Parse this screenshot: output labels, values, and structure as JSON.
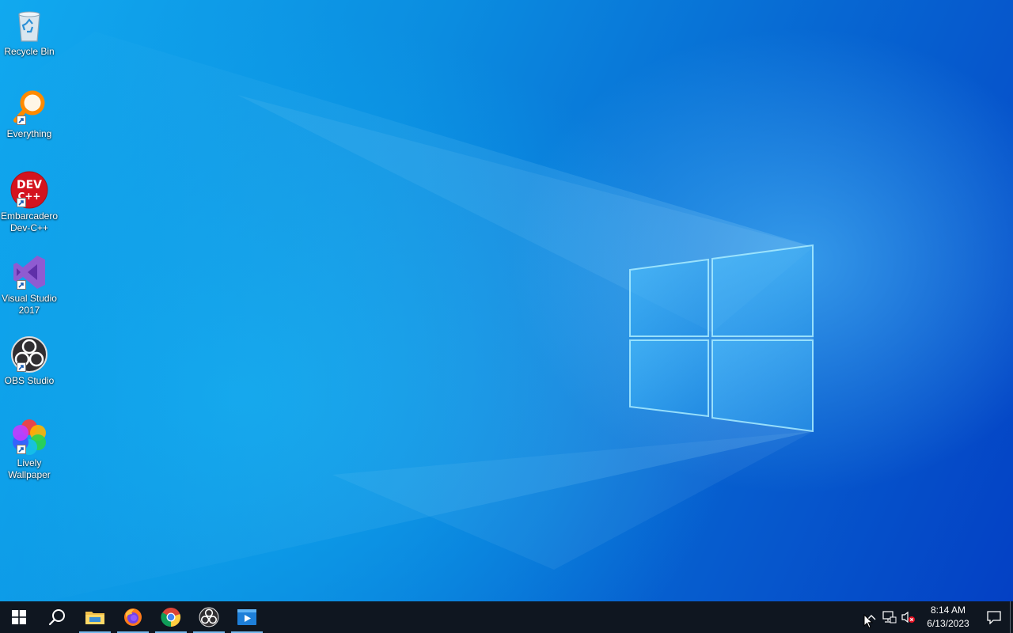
{
  "desktop": {
    "icons": [
      {
        "label": "Recycle Bin",
        "icon": "recycle-bin-icon"
      },
      {
        "label": "Everything",
        "icon": "everything-search-icon"
      },
      {
        "label": "Embarcadero Dev-C++",
        "icon": "devcpp-icon",
        "badge": "DEV C++"
      },
      {
        "label": "Visual Studio 2017",
        "icon": "visual-studio-icon"
      },
      {
        "label": "OBS Studio",
        "icon": "obs-studio-icon"
      },
      {
        "label": "Lively Wallpaper",
        "icon": "lively-wallpaper-icon"
      }
    ]
  },
  "taskbar": {
    "start": {
      "icon": "windows-start-icon"
    },
    "search": {
      "icon": "search-icon"
    },
    "pinned": [
      {
        "name": "File Explorer",
        "icon": "file-explorer-icon",
        "running": true
      },
      {
        "name": "Firefox",
        "icon": "firefox-icon",
        "running": true
      },
      {
        "name": "Chrome",
        "icon": "chrome-icon",
        "running": true
      },
      {
        "name": "OBS Studio",
        "icon": "obs-studio-icon",
        "running": true
      },
      {
        "name": "Media Player",
        "icon": "media-player-icon",
        "running": true
      }
    ],
    "tray": {
      "icons": [
        "show-hidden-icons-chevron-icon",
        "network-icon",
        "volume-muted-icon",
        "notification-icon"
      ],
      "time": "8:14 AM",
      "date": "6/13/2023"
    }
  },
  "colors": {
    "taskbar": "#0f1620",
    "wallpaper_blue": "#0a78d8",
    "running_indicator": "#76b9ed"
  }
}
